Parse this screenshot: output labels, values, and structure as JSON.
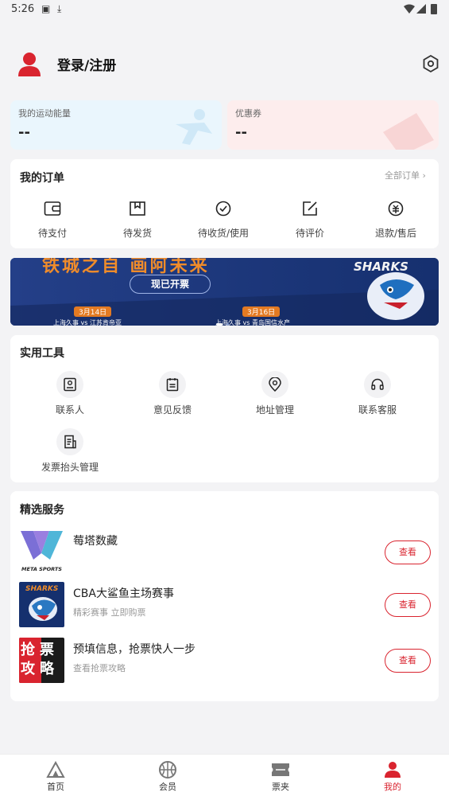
{
  "status_bar": {
    "time": "5:26"
  },
  "profile": {
    "login_label": "登录/注册"
  },
  "energy": {
    "label": "我的运动能量",
    "value": "--"
  },
  "coupon": {
    "label": "优惠券",
    "value": "--"
  },
  "orders": {
    "title": "我的订单",
    "all_label": "全部订单",
    "items": [
      {
        "label": "待支付",
        "icon": "wallet-icon"
      },
      {
        "label": "待发货",
        "icon": "box-icon"
      },
      {
        "label": "待收货/使用",
        "icon": "check-circle-icon"
      },
      {
        "label": "待评价",
        "icon": "edit-icon"
      },
      {
        "label": "退款/售后",
        "icon": "refund-icon"
      }
    ]
  },
  "banner": {
    "headline": "铁城之自 画阿未来",
    "cta": "现已开票",
    "date1": "3月14日",
    "date2": "3月16日",
    "match1": "上海久事 vs 江苏肯帝亚",
    "match2": "上海久事 vs 青岛国信水产",
    "brand": "SHARKS"
  },
  "tools": {
    "title": "实用工具",
    "items": [
      {
        "label": "联系人",
        "icon": "contact-icon"
      },
      {
        "label": "意见反馈",
        "icon": "feedback-icon"
      },
      {
        "label": "地址管理",
        "icon": "location-icon"
      },
      {
        "label": "联系客服",
        "icon": "headset-icon"
      },
      {
        "label": "发票抬头管理",
        "icon": "invoice-icon"
      }
    ]
  },
  "services": {
    "title": "精选服务",
    "items": [
      {
        "title": "莓塔数藏",
        "subtitle": "",
        "button": "查看",
        "logo_text": "META SPORTS"
      },
      {
        "title": "CBA大鲨鱼主场赛事",
        "subtitle": "精彩赛事 立即购票",
        "button": "查看",
        "logo_text": "SHARKS"
      },
      {
        "title": "预填信息，抢票快人一步",
        "subtitle": "查看抢票攻略",
        "button": "查看",
        "logo_text": "抢票攻略"
      }
    ]
  },
  "tabbar": {
    "items": [
      {
        "label": "首页",
        "active": false
      },
      {
        "label": "会员",
        "active": false
      },
      {
        "label": "票夹",
        "active": false
      },
      {
        "label": "我的",
        "active": true
      }
    ]
  },
  "colors": {
    "accent": "#d9242f",
    "energy_bg": "#eaf6fd",
    "coupon_bg": "#fdeded",
    "banner_bg": "#1f3c85"
  }
}
